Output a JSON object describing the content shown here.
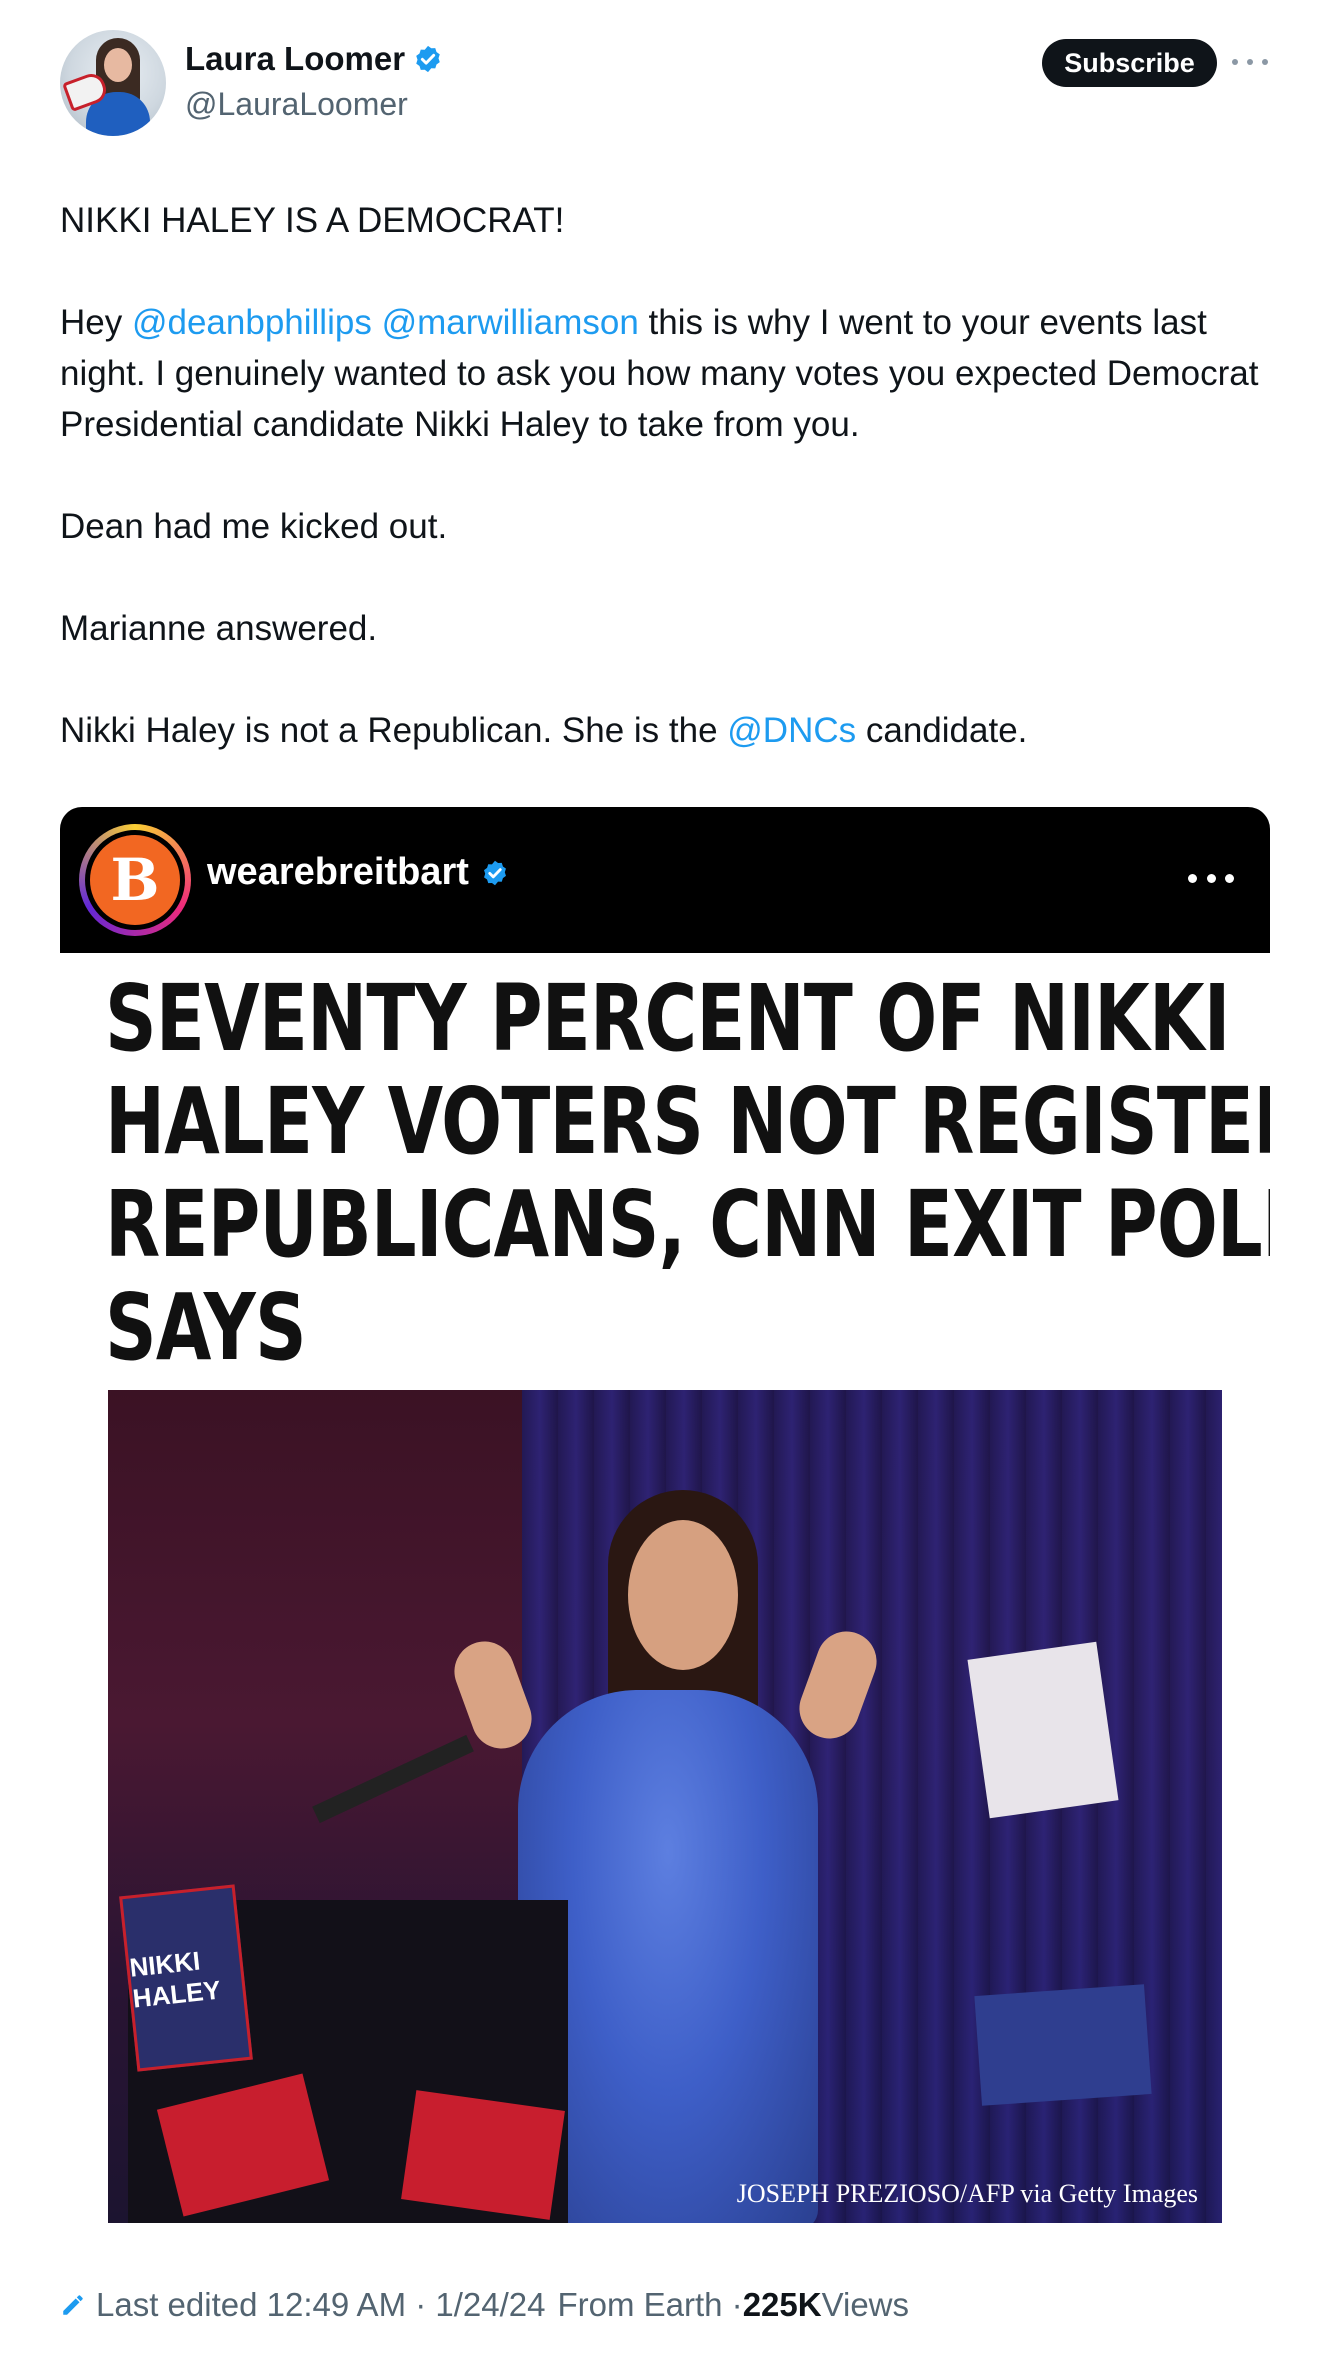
{
  "author": {
    "name": "Laura Loomer",
    "handle": "@LauraLoomer"
  },
  "subscribe_label": "Subscribe",
  "tweet": {
    "line1": "NIKKI HALEY IS A DEMOCRAT!",
    "para2_prefix": "Hey ",
    "mention1": "@deanbphillips",
    "mention2": "@marwilliamson",
    "para2_rest": " this is why I went to your events last night. I genuinely wanted to ask you how many votes you expected Democrat Presidential candidate Nikki Haley to take from you.",
    "line3": "Dean had me kicked out.",
    "line4": "Marianne answered.",
    "para5_prefix": "Nikki Haley is not a Republican. She is the ",
    "mention3": "@DNCs",
    "para5_suffix": " candidate."
  },
  "media": {
    "account": "wearebreitbart",
    "logo_letter": "B",
    "headline": [
      "SEVENTY PERCENT OF NIKKI",
      "HALEY VOTERS NOT REGISTERED",
      "REPUBLICANS, CNN EXIT POLL",
      "SAYS"
    ],
    "photo_credit": "JOSEPH PREZIOSO/AFP via Getty Images",
    "sign_text": "NIKKI HALEY"
  },
  "footer": {
    "edited": "Last edited 12:49 AM · 1/24/24",
    "location": "From Earth · ",
    "views_count": "225K",
    "views_label": " Views"
  },
  "colors": {
    "link": "#1d9bf0",
    "verified": "#1d9bf0",
    "muted": "#536471"
  }
}
